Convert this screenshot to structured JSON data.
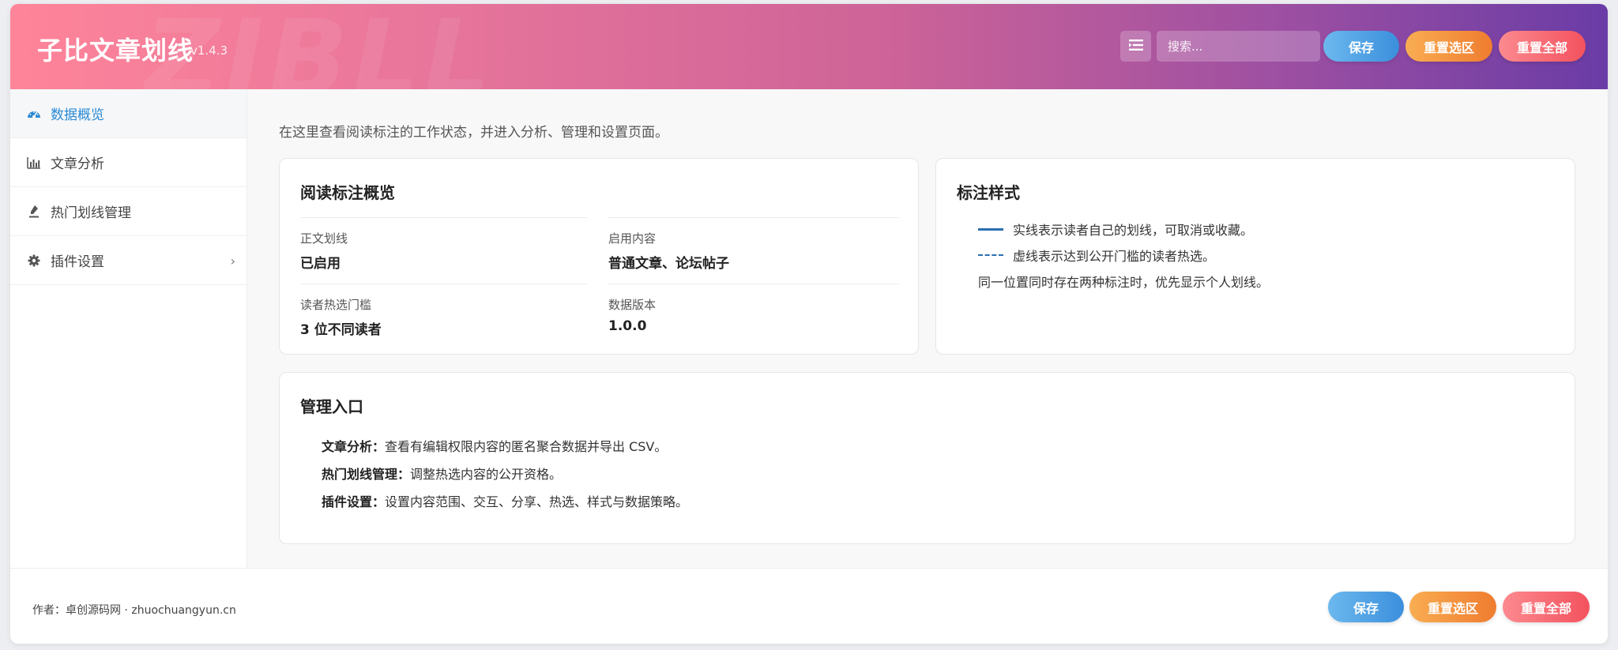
{
  "header": {
    "title": "子比文章划线",
    "version": "v1.4.3",
    "watermark": "ZIBLL",
    "search_placeholder": "搜索...",
    "buttons": {
      "save": "保存",
      "reset_section": "重置选区",
      "reset_all": "重置全部"
    }
  },
  "sidebar": {
    "items": [
      {
        "label": "数据概览",
        "icon": "dashboard-icon",
        "active": true
      },
      {
        "label": "文章分析",
        "icon": "bar-chart-icon",
        "active": false
      },
      {
        "label": "热门划线管理",
        "icon": "pen-icon",
        "active": false
      },
      {
        "label": "插件设置",
        "icon": "gear-icon",
        "active": false,
        "chevron": "›"
      }
    ]
  },
  "main": {
    "intro": "在这里查看阅读标注的工作状态，并进入分析、管理和设置页面。",
    "overview": {
      "title": "阅读标注概览",
      "fields": [
        {
          "label": "正文划线",
          "value": "已启用"
        },
        {
          "label": "启用内容",
          "value": "普通文章、论坛帖子"
        },
        {
          "label": "读者热选门槛",
          "value": "3 位不同读者"
        },
        {
          "label": "数据版本",
          "value": "1.0.0"
        }
      ]
    },
    "styles": {
      "title": "标注样式",
      "solid": "实线表示读者自己的划线，可取消或收藏。",
      "dashed": "虚线表示达到公开门槛的读者热选。",
      "note": "同一位置同时存在两种标注时，优先显示个人划线。"
    },
    "entries": {
      "title": "管理入口",
      "items": [
        {
          "name": "文章分析：",
          "desc": "查看有编辑权限内容的匿名聚合数据并导出 CSV。"
        },
        {
          "name": "热门划线管理：",
          "desc": "调整热选内容的公开资格。"
        },
        {
          "name": "插件设置：",
          "desc": "设置内容范围、交互、分享、热选、样式与数据策略。"
        }
      ]
    }
  },
  "footer": {
    "author": "作者：卓创源码网 · zhuochuangyun.cn",
    "buttons": {
      "save": "保存",
      "reset_section": "重置选区",
      "reset_all": "重置全部"
    }
  },
  "colors": {
    "header_gradient_start": "#fe8499",
    "header_gradient_end": "#6a3ca6",
    "active_nav": "#2a8ad4",
    "save_button": "#3b8fdc",
    "reset_section_button": "#ef7c30",
    "reset_all_button": "#f3525e",
    "annotation_line": "#2a6fb0"
  }
}
